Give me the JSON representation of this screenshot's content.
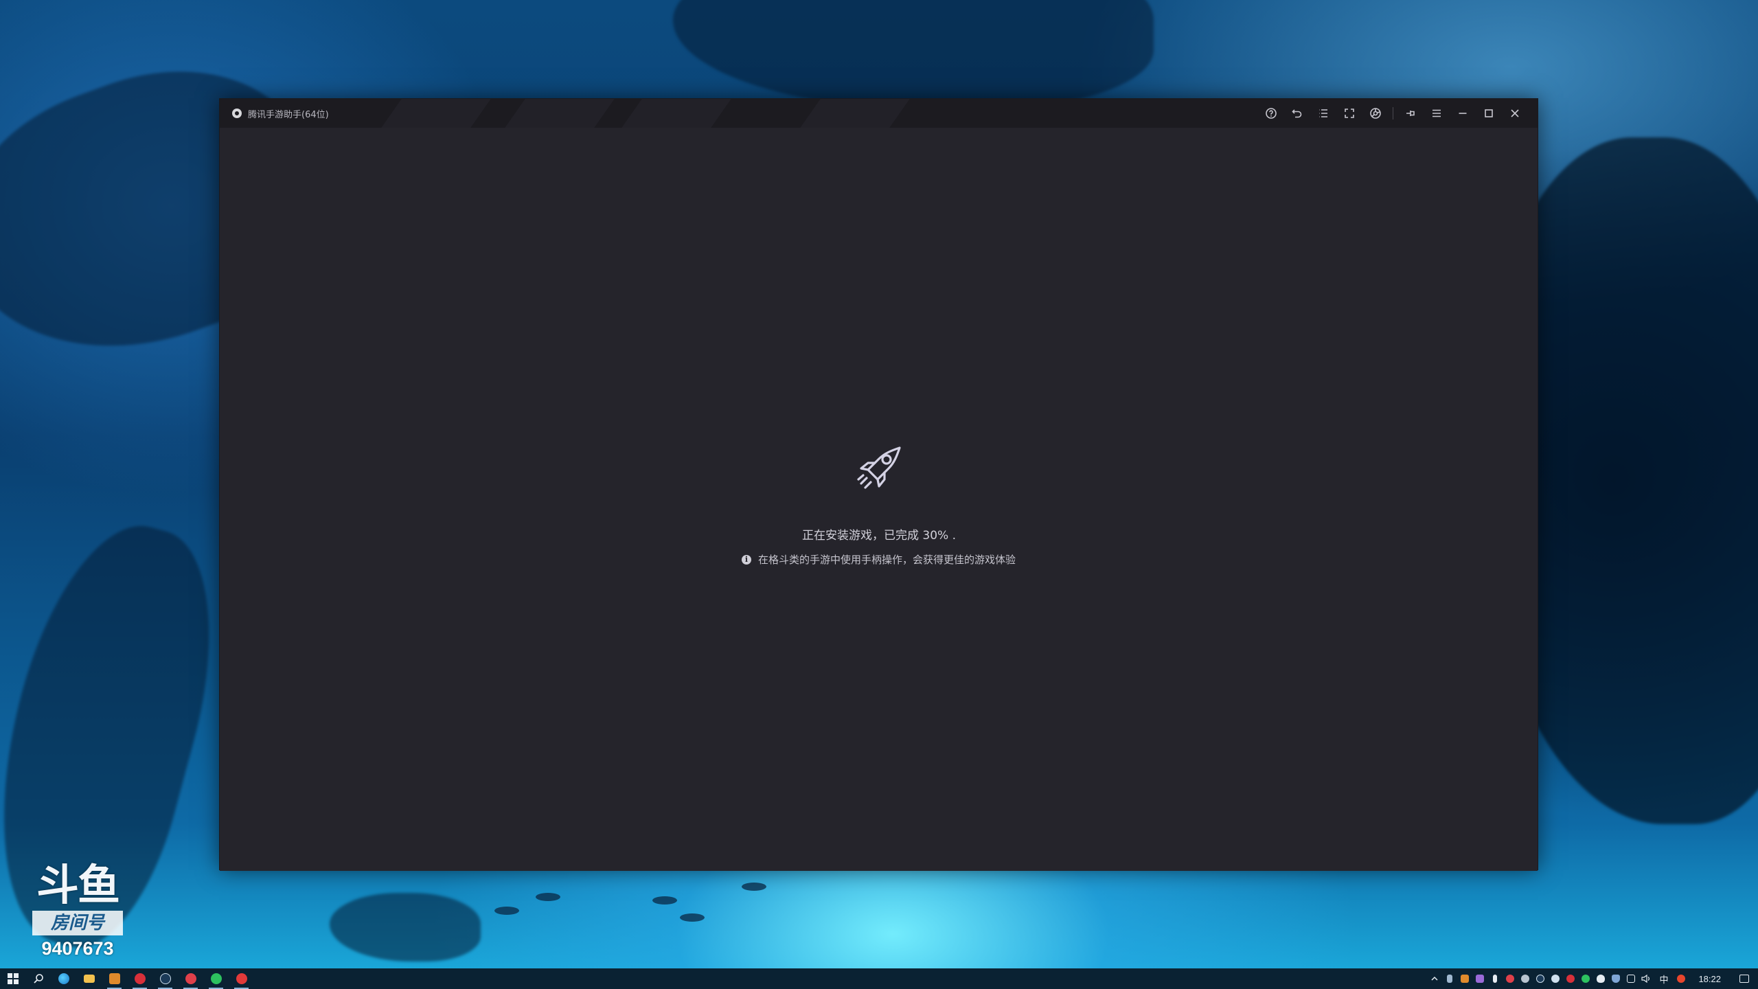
{
  "window": {
    "title": "腾讯手游助手(64位)"
  },
  "title_controls": [
    {
      "name": "help-icon"
    },
    {
      "name": "back-icon"
    },
    {
      "name": "list-icon"
    },
    {
      "name": "fullscreen-icon"
    },
    {
      "name": "screenshot-icon"
    },
    {
      "name": "pin-icon"
    },
    {
      "name": "menu-icon"
    },
    {
      "name": "minimize-icon"
    },
    {
      "name": "maximize-icon"
    },
    {
      "name": "close-icon"
    }
  ],
  "loading": {
    "status": "正在安装游戏，已完成 30% .",
    "progress_percent": 30,
    "tip": "在格斗类的手游中使用手柄操作，会获得更佳的游戏体验"
  },
  "watermark": {
    "logo": "斗鱼",
    "badge": "房间号",
    "room_number": "9407673"
  },
  "taskbar": {
    "apps": [
      "start-icon",
      "search-icon",
      "edge-icon",
      "file-explorer-icon",
      "app-orange-icon",
      "netease-music-icon",
      "steam-icon",
      "app-red-icon",
      "wechat-icon",
      "tencent-assistant-icon"
    ],
    "tray_language": "中",
    "clock": "18:22"
  }
}
